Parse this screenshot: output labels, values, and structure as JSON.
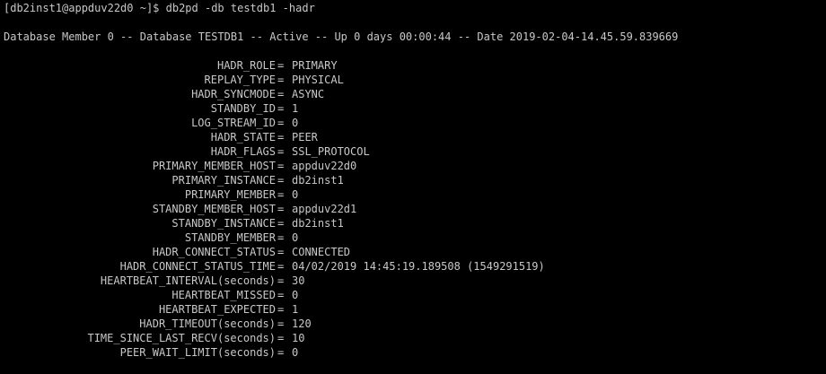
{
  "terminal": {
    "prompt": "[db2inst1@appduv22d0 ~]$ ",
    "command": "db2pd -db testdb1 -hadr",
    "status_line": "Database Member 0 -- Database TESTDB1 -- Active -- Up 0 days 00:00:44 -- Date 2019-02-04-14.45.59.839669",
    "rows": [
      {
        "key": "HADR_ROLE",
        "value": "PRIMARY"
      },
      {
        "key": "REPLAY_TYPE",
        "value": "PHYSICAL"
      },
      {
        "key": "HADR_SYNCMODE",
        "value": "ASYNC"
      },
      {
        "key": "STANDBY_ID",
        "value": "1"
      },
      {
        "key": "LOG_STREAM_ID",
        "value": "0"
      },
      {
        "key": "HADR_STATE",
        "value": "PEER"
      },
      {
        "key": "HADR_FLAGS",
        "value": "SSL_PROTOCOL"
      },
      {
        "key": "PRIMARY_MEMBER_HOST",
        "value": "appduv22d0"
      },
      {
        "key": "PRIMARY_INSTANCE",
        "value": "db2inst1"
      },
      {
        "key": "PRIMARY_MEMBER",
        "value": "0"
      },
      {
        "key": "STANDBY_MEMBER_HOST",
        "value": "appduv22d1"
      },
      {
        "key": "STANDBY_INSTANCE",
        "value": "db2inst1"
      },
      {
        "key": "STANDBY_MEMBER",
        "value": "0"
      },
      {
        "key": "HADR_CONNECT_STATUS",
        "value": "CONNECTED"
      },
      {
        "key": "HADR_CONNECT_STATUS_TIME",
        "value": "04/02/2019 14:45:19.189508 (1549291519)"
      },
      {
        "key": "HEARTBEAT_INTERVAL(seconds)",
        "value": "30"
      },
      {
        "key": "HEARTBEAT_MISSED",
        "value": "0"
      },
      {
        "key": "HEARTBEAT_EXPECTED",
        "value": "1"
      },
      {
        "key": "HADR_TIMEOUT(seconds)",
        "value": "120"
      },
      {
        "key": "TIME_SINCE_LAST_RECV(seconds)",
        "value": "10"
      },
      {
        "key": "PEER_WAIT_LIMIT(seconds)",
        "value": "0"
      }
    ],
    "separator": "=",
    "colors": {
      "background": "#000000",
      "text": "#c8c8c8"
    }
  }
}
